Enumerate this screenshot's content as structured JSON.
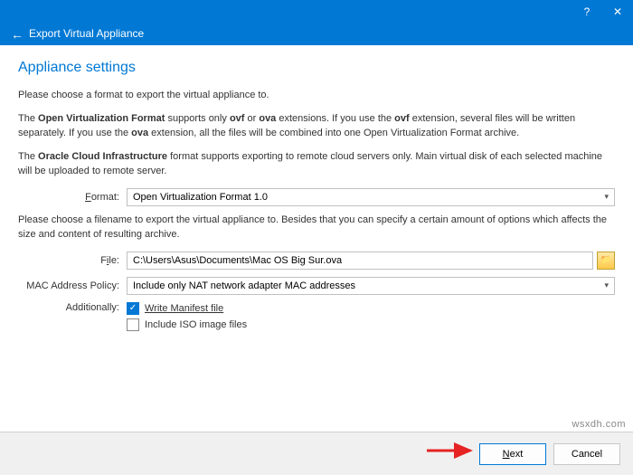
{
  "titlebar": {
    "title": "Export Virtual Appliance",
    "help": "?",
    "close": "✕"
  },
  "heading": "Appliance settings",
  "paragraphs": {
    "p1": "Please choose a format to export the virtual appliance to.",
    "p2a": "The ",
    "p2b": "Open Virtualization Format",
    "p2c": " supports only ",
    "p2d": "ovf",
    "p2e": " or ",
    "p2f": "ova",
    "p2g": " extensions. If you use the ",
    "p2h": "ovf",
    "p2i": " extension, several files will be written separately. If you use the ",
    "p2j": "ova",
    "p2k": " extension, all the files will be combined into one Open Virtualization Format archive.",
    "p3a": "The ",
    "p3b": "Oracle Cloud Infrastructure",
    "p3c": " format supports exporting to remote cloud servers only. Main virtual disk of each selected machine will be uploaded to remote server.",
    "p4": "Please choose a filename to export the virtual appliance to. Besides that you can specify a certain amount of options which affects the size and content of resulting archive."
  },
  "labels": {
    "format": "Format:",
    "file": "File:",
    "mac": "MAC Address Policy:",
    "additionally": "Additionally:"
  },
  "values": {
    "format": "Open Virtualization Format 1.0",
    "file": "C:\\Users\\Asus\\Documents\\Mac OS Big Sur.ova",
    "mac": "Include only NAT network adapter MAC addresses"
  },
  "checkboxes": {
    "manifest": "Write Manifest file",
    "iso": "Include ISO image files"
  },
  "buttons": {
    "next": "Next",
    "cancel": "Cancel"
  },
  "watermark": "wsxdh.com"
}
